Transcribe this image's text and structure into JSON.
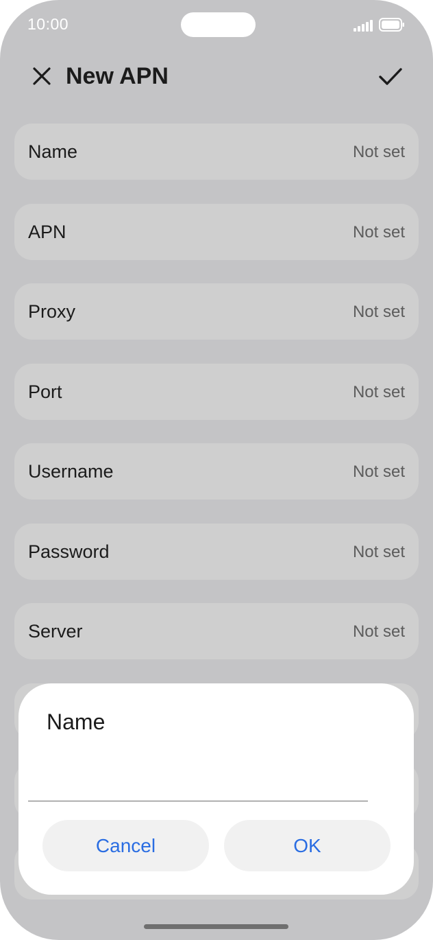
{
  "status_bar": {
    "time": "10:00",
    "signal_icon": "cellular-signal-icon",
    "battery_icon": "battery-icon"
  },
  "header": {
    "title": "New APN",
    "close_icon": "close-icon",
    "confirm_icon": "checkmark-icon"
  },
  "fields": [
    {
      "label": "Name",
      "value": "Not set"
    },
    {
      "label": "APN",
      "value": "Not set"
    },
    {
      "label": "Proxy",
      "value": "Not set"
    },
    {
      "label": "Port",
      "value": "Not set"
    },
    {
      "label": "Username",
      "value": "Not set"
    },
    {
      "label": "Password",
      "value": "Not set"
    },
    {
      "label": "Server",
      "value": "Not set"
    }
  ],
  "dialog": {
    "title": "Name",
    "input_value": "",
    "cancel_label": "Cancel",
    "ok_label": "OK"
  },
  "colors": {
    "accent": "#2a6de2",
    "scrim_background": "#c4c4c6",
    "row_background": "#cfcfcf",
    "dialog_background": "#ffffff"
  }
}
